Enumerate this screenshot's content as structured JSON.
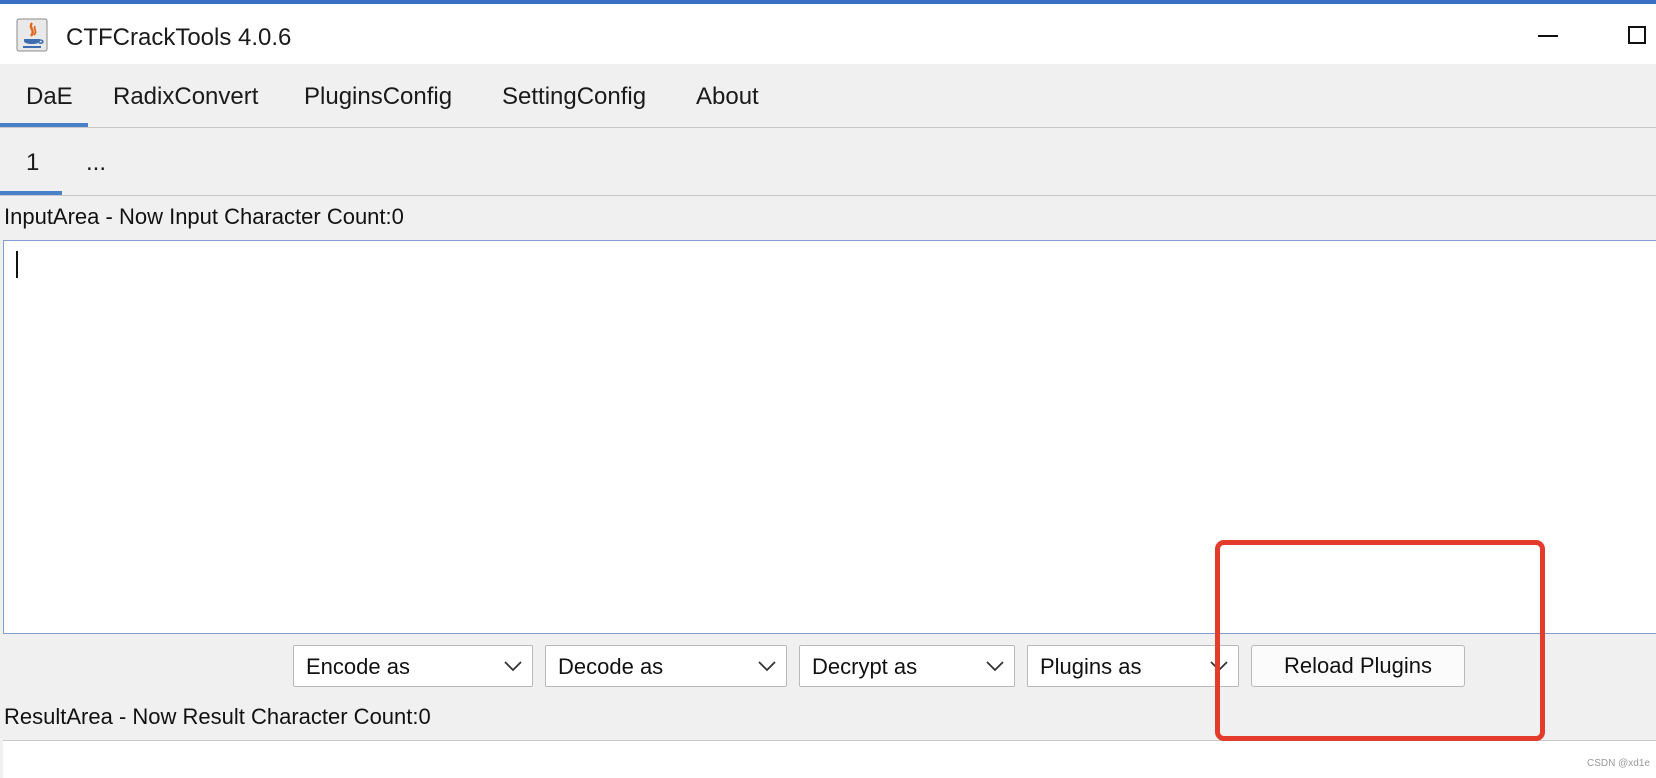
{
  "window": {
    "title": "CTFCrackTools 4.0.6",
    "controls": [
      "minimize-icon",
      "maximize-icon"
    ]
  },
  "menu_tabs": [
    {
      "label": "DaE",
      "active": true
    },
    {
      "label": "RadixConvert",
      "active": false
    },
    {
      "label": "PluginsConfig",
      "active": false
    },
    {
      "label": "SettingConfig",
      "active": false
    },
    {
      "label": "About",
      "active": false
    }
  ],
  "sub_tabs": [
    {
      "label": "1",
      "active": true
    },
    {
      "label": "...",
      "active": false
    }
  ],
  "input_area": {
    "label": "InputArea - Now Input Character Count:0",
    "value": ""
  },
  "toolbar": {
    "encode": "Encode as",
    "decode": "Decode as",
    "decrypt": "Decrypt as",
    "plugins": "Plugins as",
    "reload": "Reload Plugins"
  },
  "result_area": {
    "label": "ResultArea - Now Result Character Count:0",
    "value": ""
  },
  "watermark": "CSDN @xd1e",
  "colors": {
    "accent": "#4a7fc9",
    "highlight": "#e33b2c",
    "background": "#f0f0f0"
  }
}
